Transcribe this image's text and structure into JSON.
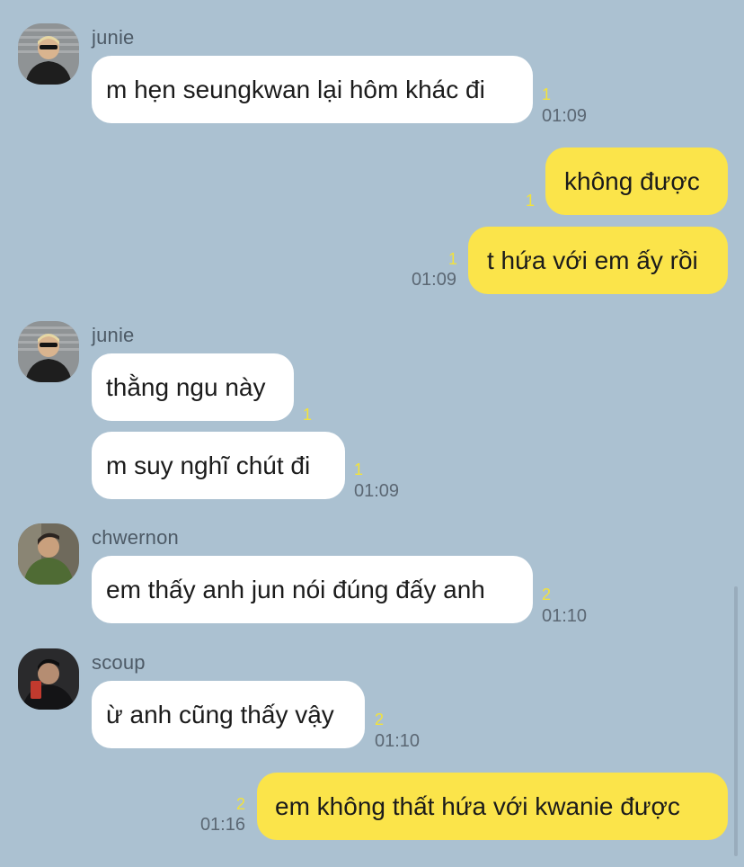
{
  "colors": {
    "background": "#abc1d1",
    "incoming_bubble": "#ffffff",
    "outgoing_bubble": "#fbe44a",
    "unread_count": "#f2e23c"
  },
  "messages": [
    {
      "sender": "junie",
      "text": "m hẹn seungkwan lại hôm khác đi",
      "unread": "1",
      "time": "01:09"
    },
    {
      "sender": "me",
      "text": "không được",
      "unread": "1",
      "time": ""
    },
    {
      "sender": "me",
      "text": "t hứa với em ấy rồi",
      "unread": "1",
      "time": "01:09"
    },
    {
      "sender": "junie",
      "text": "thằng ngu này",
      "unread": "1",
      "time": ""
    },
    {
      "sender": "junie",
      "text": "m suy nghĩ chút đi",
      "unread": "1",
      "time": "01:09"
    },
    {
      "sender": "chwernon",
      "text": "em thấy anh jun nói đúng đấy anh",
      "unread": "2",
      "time": "01:10"
    },
    {
      "sender": "scoup",
      "text": "ừ anh cũng thấy vậy",
      "unread": "2",
      "time": "01:10"
    },
    {
      "sender": "me",
      "text": "em không thất hứa với kwanie được",
      "unread": "2",
      "time": "01:16"
    }
  ]
}
